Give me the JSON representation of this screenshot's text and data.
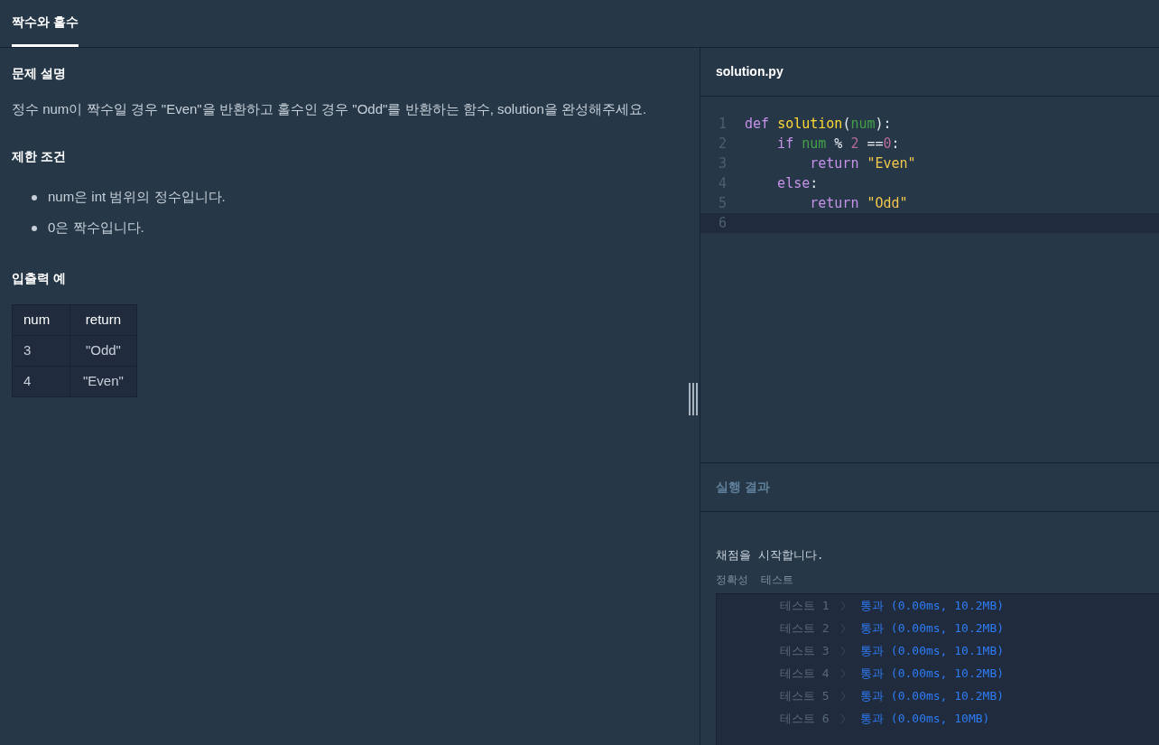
{
  "tabs": [
    {
      "label": "짝수와 홀수",
      "selected": true
    }
  ],
  "problem": {
    "sections": [
      {
        "heading": "문제 설명",
        "kind": "paragraph",
        "text": "정수 num이 짝수일 경우 \"Even\"을 반환하고 홀수인 경우 \"Odd\"를 반환하는 함수, solution을 완성해주세요."
      },
      {
        "heading": "제한 조건",
        "kind": "list",
        "items": [
          "num은 int 범위의 정수입니다.",
          "0은 짝수입니다."
        ]
      },
      {
        "heading": "입출력 예",
        "kind": "table",
        "columns": [
          "num",
          "return"
        ],
        "rows": [
          [
            "3",
            "\"Odd\""
          ],
          [
            "4",
            "\"Even\""
          ]
        ]
      }
    ]
  },
  "editor": {
    "filename": "solution.py",
    "lines": [
      {
        "number": "1",
        "active": false,
        "tokens": [
          {
            "text": "def ",
            "kind": "keyword"
          },
          {
            "text": "solution",
            "kind": "function"
          },
          {
            "text": "(",
            "kind": "plain"
          },
          {
            "text": "num",
            "kind": "variable"
          },
          {
            "text": "):",
            "kind": "plain"
          }
        ]
      },
      {
        "number": "2",
        "active": false,
        "tokens": [
          {
            "text": "    if ",
            "kind": "keyword"
          },
          {
            "text": "num",
            "kind": "variable"
          },
          {
            "text": " % ",
            "kind": "plain"
          },
          {
            "text": "2",
            "kind": "number"
          },
          {
            "text": " ==",
            "kind": "plain"
          },
          {
            "text": "0",
            "kind": "number"
          },
          {
            "text": ":",
            "kind": "plain"
          }
        ]
      },
      {
        "number": "3",
        "active": false,
        "tokens": [
          {
            "text": "        return ",
            "kind": "keyword"
          },
          {
            "text": "\"Even\"",
            "kind": "string"
          }
        ]
      },
      {
        "number": "4",
        "active": false,
        "tokens": [
          {
            "text": "    else",
            "kind": "keyword"
          },
          {
            "text": ":",
            "kind": "plain"
          }
        ]
      },
      {
        "number": "5",
        "active": false,
        "tokens": [
          {
            "text": "        return ",
            "kind": "keyword"
          },
          {
            "text": "\"Odd\"",
            "kind": "string"
          }
        ]
      },
      {
        "number": "6",
        "active": true
      }
    ]
  },
  "results": {
    "title": "실행 결과",
    "message": "채점을 시작합니다.",
    "group": "정확성  테스트",
    "tests": [
      {
        "label": "테스트 1",
        "result": "통과 (0.00ms, 10.2MB)"
      },
      {
        "label": "테스트 2",
        "result": "통과 (0.00ms, 10.2MB)"
      },
      {
        "label": "테스트 3",
        "result": "통과 (0.00ms, 10.1MB)"
      },
      {
        "label": "테스트 4",
        "result": "통과 (0.00ms, 10.2MB)"
      },
      {
        "label": "테스트 5",
        "result": "통과 (0.00ms, 10.2MB)"
      },
      {
        "label": "테스트 6",
        "result": "통과 (0.00ms, 10MB)"
      }
    ]
  }
}
